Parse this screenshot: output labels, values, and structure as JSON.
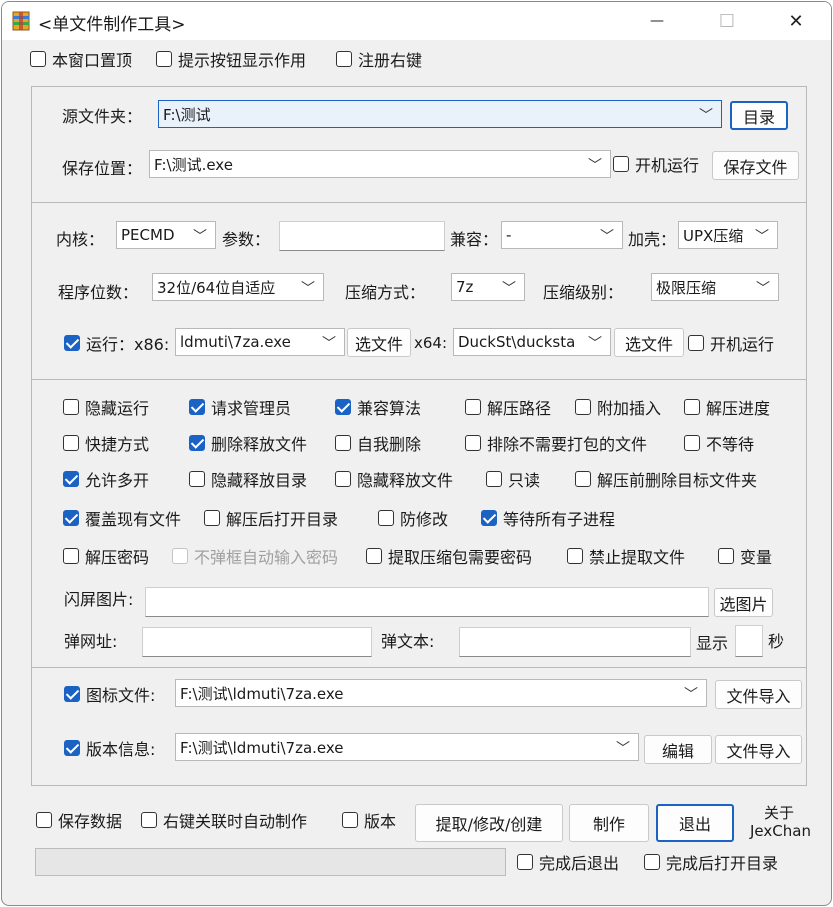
{
  "window": {
    "title": "<单文件制作工具>",
    "minimize_glyph": "—",
    "maximize_glyph": "☐",
    "close_glyph": "✕"
  },
  "top_options": [
    {
      "label": "本窗口置顶",
      "checked": false
    },
    {
      "label": "提示按钮显示作用",
      "checked": false
    },
    {
      "label": "注册右键",
      "checked": false
    }
  ],
  "source": {
    "folder_label": "源文件夹：",
    "folder_value": "F:\\测试",
    "folder_button": "目录",
    "save_label": "保存位置：",
    "save_value": "F:\\测试.exe",
    "startup_label": "开机运行",
    "startup_checked": false,
    "save_button": "保存文件"
  },
  "core": {
    "kernel_label": "内核：",
    "kernel_value": "PECMD",
    "params_label": "参数：",
    "params_value": "",
    "compat_label": "兼容：",
    "compat_value": "-",
    "shell_label": "加壳：",
    "shell_value": "UPX压缩",
    "bits_label": "程序位数：",
    "bits_value": "32位/64位自适应",
    "method_label": "压缩方式：",
    "method_value": "7z",
    "level_label": "压缩级别：",
    "level_value": "极限压缩",
    "run_label": "运行：x86:",
    "run_checked": true,
    "x86_value": "ldmuti\\7za.exe",
    "x86_button": "选文件",
    "x64_label": "x64:",
    "x64_value": "DuckSt\\ducksta",
    "x64_button": "选文件",
    "run_startup_label": "开机运行",
    "run_startup_checked": false
  },
  "options": {
    "rows": [
      [
        {
          "label": "隐藏运行",
          "checked": false
        },
        {
          "label": "请求管理员",
          "checked": true
        },
        {
          "label": "兼容算法",
          "checked": true
        },
        {
          "label": "解压路径",
          "checked": false
        },
        {
          "label": "附加插入",
          "checked": false
        },
        {
          "label": "解压进度",
          "checked": false
        }
      ],
      [
        {
          "label": "快捷方式",
          "checked": false
        },
        {
          "label": "删除释放文件",
          "checked": true
        },
        {
          "label": "自我删除",
          "checked": false
        },
        {
          "label": "排除不需要打包的文件",
          "checked": false
        },
        {
          "label": "不等待",
          "checked": false
        }
      ],
      [
        {
          "label": "允许多开",
          "checked": true
        },
        {
          "label": "隐藏释放目录",
          "checked": false
        },
        {
          "label": "隐藏释放文件",
          "checked": false
        },
        {
          "label": "只读",
          "checked": false
        },
        {
          "label": "解压前删除目标文件夹",
          "checked": false
        }
      ],
      [
        {
          "label": "覆盖现有文件",
          "checked": true
        },
        {
          "label": "解压后打开目录",
          "checked": false
        },
        {
          "label": "防修改",
          "checked": false
        },
        {
          "label": "等待所有子进程",
          "checked": true
        }
      ],
      [
        {
          "label": "解压密码",
          "checked": false
        },
        {
          "label": "不弹框自动输入密码",
          "checked": false,
          "disabled": true
        },
        {
          "label": "提取压缩包需要密码",
          "checked": false
        },
        {
          "label": "禁止提取文件",
          "checked": false
        },
        {
          "label": "变量",
          "checked": false
        }
      ]
    ],
    "splash_label": "闪屏图片:",
    "splash_value": "",
    "splash_button": "选图片",
    "popup_url_label": "弹网址:",
    "popup_url_value": "",
    "popup_text_label": "弹文本:",
    "popup_text_value": "",
    "display_label": "显示",
    "display_value": "",
    "seconds_label": "秒"
  },
  "icon_version": {
    "icon_label": "图标文件:",
    "icon_checked": true,
    "icon_value": "F:\\测试\\ldmuti\\7za.exe",
    "icon_import_button": "文件导入",
    "version_label": "版本信息:",
    "version_checked": true,
    "version_value": "F:\\测试\\ldmuti\\7za.exe",
    "edit_button": "编辑",
    "version_import_button": "文件导入"
  },
  "footer": {
    "save_data_label": "保存数据",
    "save_data_checked": false,
    "auto_make_label": "右键关联时自动制作",
    "auto_make_checked": false,
    "version_label": "版本",
    "version_checked": false,
    "extract_button": "提取/修改/创建",
    "make_button": "制作",
    "exit_button": "退出",
    "about_line1": "关于",
    "about_line2": "JexChan",
    "progress": 0,
    "exit_after_label": "完成后退出",
    "exit_after_checked": false,
    "open_after_label": "完成后打开目录",
    "open_after_checked": false
  }
}
